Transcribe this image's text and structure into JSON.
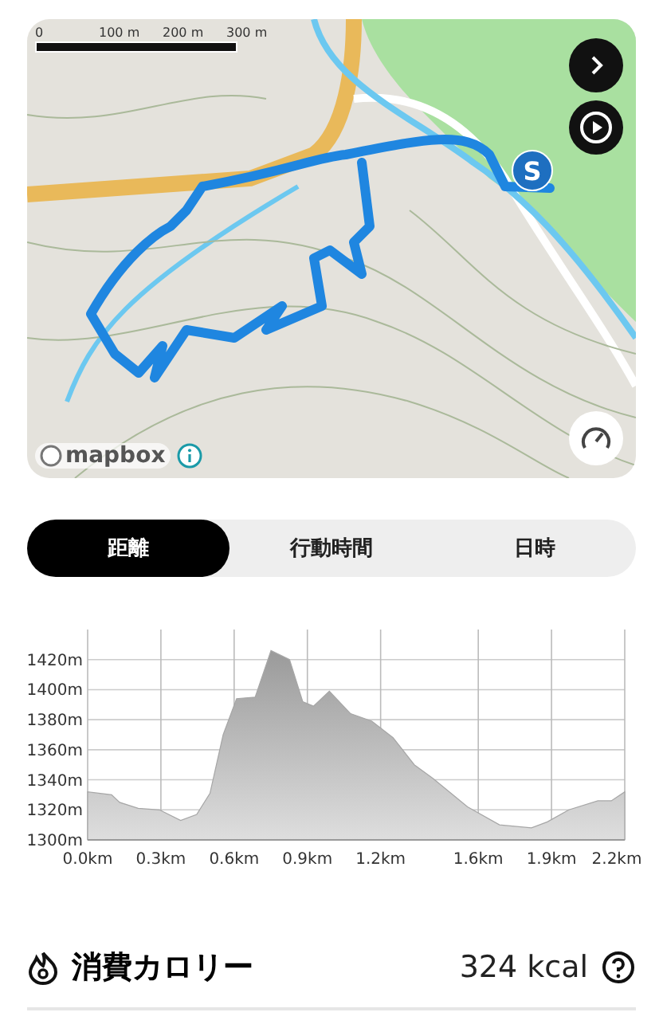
{
  "map": {
    "scale_labels": [
      "0",
      "100 m",
      "200 m",
      "300 m"
    ],
    "start_marker": "S",
    "attribution": "mapbox"
  },
  "tabs": [
    {
      "label": "距離",
      "selected": true
    },
    {
      "label": "行動時間",
      "selected": false
    },
    {
      "label": "日時",
      "selected": false
    }
  ],
  "elevation": {
    "chart_data": {
      "type": "area",
      "x": [
        0,
        0.098,
        0.131,
        0.207,
        0.294,
        0.381,
        0.447,
        0.501,
        0.555,
        0.61,
        0.686,
        0.751,
        0.827,
        0.881,
        0.925,
        0.99,
        1.077,
        1.164,
        1.251,
        1.338,
        1.414,
        1.556,
        1.687,
        1.818,
        1.883,
        1.971,
        2.09,
        2.145,
        2.2
      ],
      "series": [
        {
          "color": "#a6a6a6",
          "values": [
            1332,
            1330,
            1325,
            1321,
            1320,
            1313,
            1317,
            1331,
            1370,
            1394,
            1395,
            1426,
            1420,
            1392,
            1389,
            1399,
            1384,
            1379,
            1368,
            1350,
            1341,
            1322,
            1310,
            1308,
            1312,
            1320,
            1326,
            1326,
            1332
          ]
        }
      ],
      "xlim": [
        0,
        2.2
      ],
      "ylim": [
        1300,
        1440
      ],
      "grid": true,
      "xticks": [
        {
          "value": 0,
          "label": "0.0km"
        },
        {
          "value": 0.3,
          "label": "0.3km"
        },
        {
          "value": 0.6,
          "label": "0.6km"
        },
        {
          "value": 0.9,
          "label": "0.9km"
        },
        {
          "value": 1.2,
          "label": "1.2km"
        },
        {
          "value": 1.6,
          "label": "1.6km"
        },
        {
          "value": 1.9,
          "label": "1.9km"
        },
        {
          "value": 2.2,
          "label": "2.2km"
        }
      ],
      "yticks": [
        {
          "value": 1300,
          "label": "1300m"
        },
        {
          "value": 1320,
          "label": "1320m"
        },
        {
          "value": 1340,
          "label": "1340m"
        },
        {
          "value": 1360,
          "label": "1360m"
        },
        {
          "value": 1380,
          "label": "1380m"
        },
        {
          "value": 1400,
          "label": "1400m"
        },
        {
          "value": 1420,
          "label": "1420m"
        }
      ]
    }
  },
  "calories": {
    "label": "消費カロリー",
    "value": "324 kcal"
  }
}
